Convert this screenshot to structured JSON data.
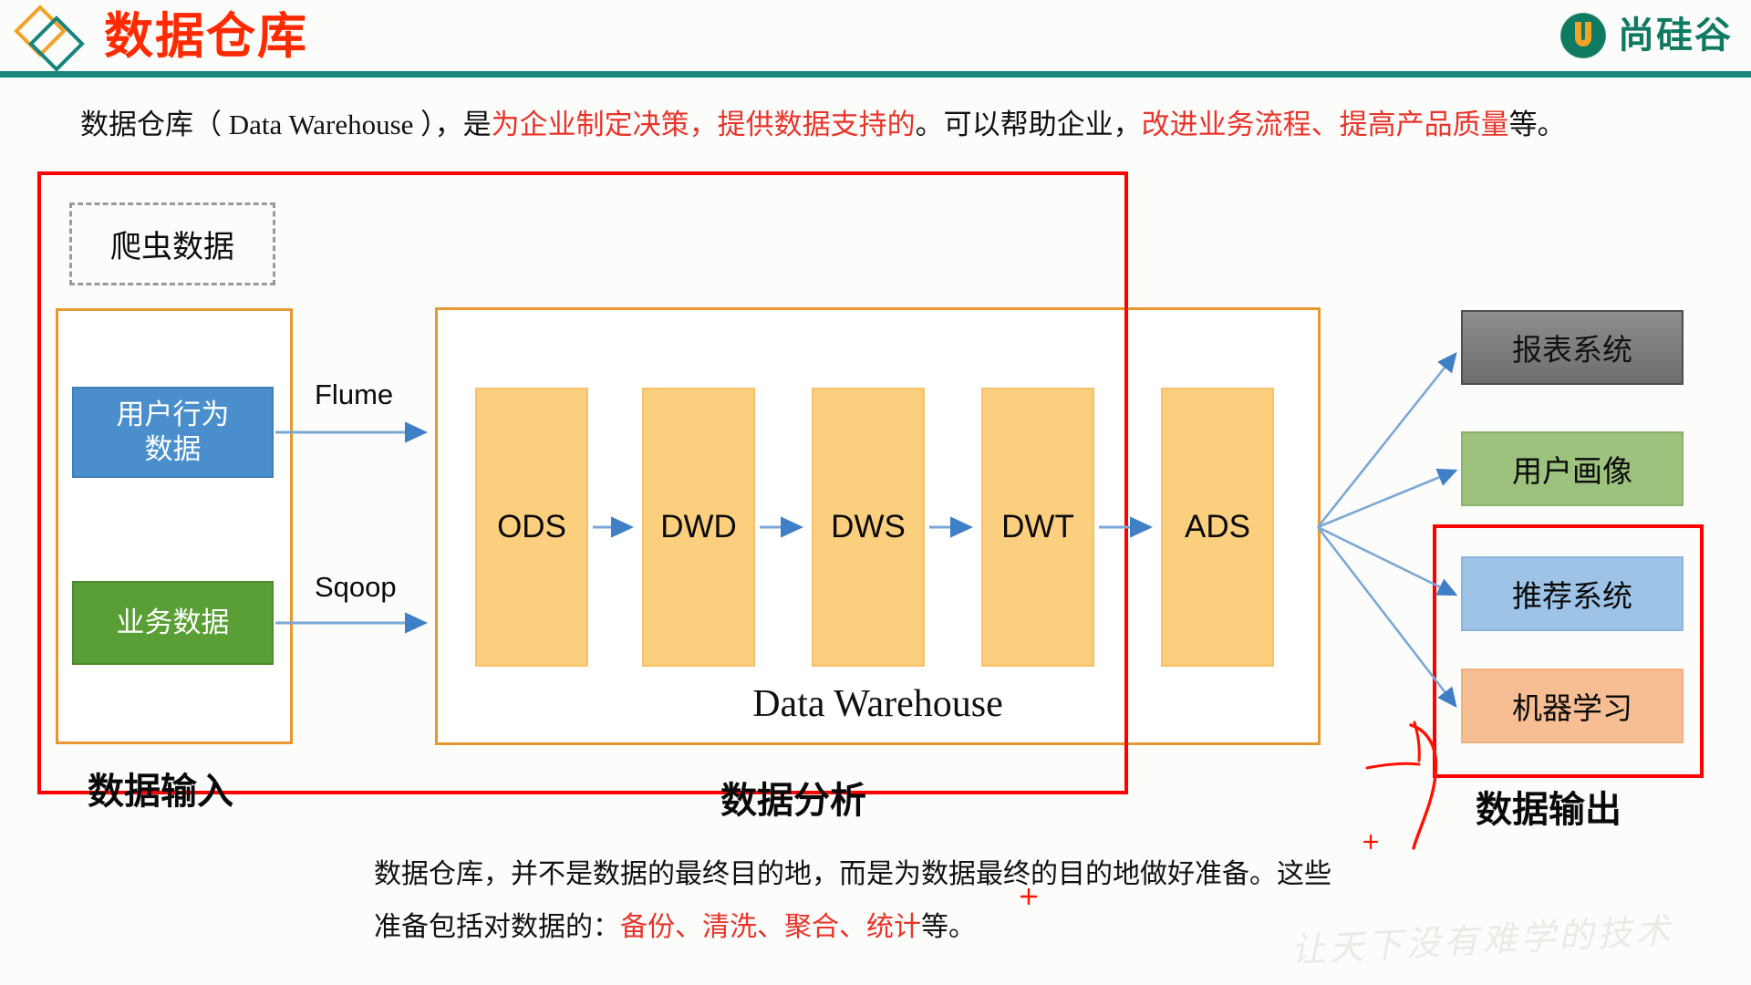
{
  "header": {
    "title": "数据仓库",
    "brand_name": "尚硅谷",
    "brand_color": "#0E7A62",
    "accent_red": "#FF2A00",
    "rule_color": "#17857C",
    "diamond_orange": "#F2A226",
    "diamond_teal": "#17857C"
  },
  "intro": {
    "part1": "数据仓库（ ",
    "en": "Data Warehouse",
    "part2": " ），是",
    "red1": "为企业制定决策，提供数据支持的",
    "part3": "。可以帮助企业，",
    "red2": "改进业务流程、提高产品质量",
    "part4": "等。"
  },
  "diagram": {
    "crawler_box": "爬虫数据",
    "sources": [
      {
        "label": "用户行为\n数据",
        "line1": "用户行为",
        "line2": "数据",
        "color": "#4A8FCC"
      },
      {
        "label": "业务数据",
        "line1": "业务数据",
        "line2": "",
        "color": "#5A9E36"
      }
    ],
    "pipes": [
      {
        "label": "Flume"
      },
      {
        "label": "Sqoop"
      }
    ],
    "layers": [
      {
        "label": "ODS"
      },
      {
        "label": "DWD"
      },
      {
        "label": "DWS"
      },
      {
        "label": "DWT"
      },
      {
        "label": "ADS"
      }
    ],
    "layer_color": "#FCCF7E",
    "dw_caption": "Data Warehouse",
    "outputs": [
      {
        "label": "报表系统",
        "color": "#7E7E7E"
      },
      {
        "label": "用户画像",
        "color": "#9CC27E"
      },
      {
        "label": "推荐系统",
        "color": "#9DC3E6"
      },
      {
        "label": "机器学习",
        "color": "#F7BE94"
      }
    ],
    "captions": {
      "input": "数据输入",
      "analysis": "数据分析",
      "output": "数据输出"
    },
    "highlight_color": "#FF0000",
    "container_color": "#E8962F",
    "arrow_color": "#7BA7D7"
  },
  "outro": {
    "line1": "数据仓库，并不是数据的最终目的地，而是为数据最终的目的地做好准备。这些",
    "line2_black": "准备包括对数据的：",
    "line2_red": "备份、清洗、聚合、统计",
    "line2_tail": "等。"
  },
  "watermark": "让天下没有难学的技术"
}
